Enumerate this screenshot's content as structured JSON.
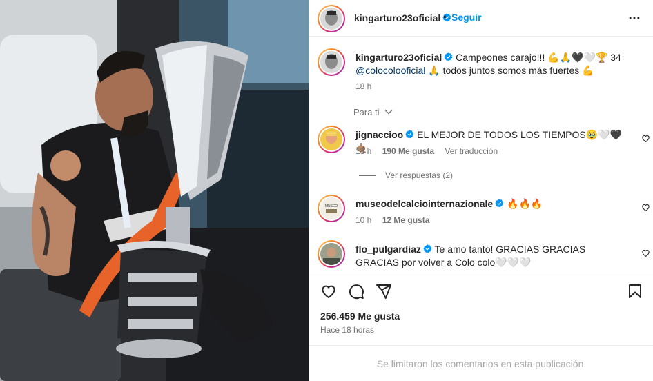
{
  "post": {
    "username": "kingarturo23oficial",
    "follow_label": "Seguir",
    "follow_separator": "•"
  },
  "caption": {
    "username": "kingarturo23oficial",
    "text_line1": "Campeones carajo!!! 💪🙏🖤🤍🏆 34",
    "mention": "@colocolooficial",
    "text_line2": " 🙏 todos juntos somos más fuertes 💪",
    "time": "18 h"
  },
  "for_you_label": "Para ti",
  "comments": [
    {
      "username": "jignaccioo",
      "text": "EL MEJOR DE TODOS LOS TIEMPOS🥹🤍🖤🤙🏽",
      "time": "18 h",
      "likes": "190 Me gusta",
      "translate": "Ver traducción"
    },
    {
      "username": "museodelcalciointernazionale",
      "text": "🔥🔥🔥",
      "time": "10 h",
      "likes": "12 Me gusta"
    },
    {
      "username": "flo_pulgardiaz",
      "text": "Te amo tanto! GRACIAS GRACIAS GRACIAS por volver a Colo colo🤍🤍🤍"
    }
  ],
  "view_replies": "Ver respuestas (2)",
  "like_count": "256.459 Me gusta",
  "posted_ago": "Hace 18 horas",
  "comments_closed": "Se limitaron los comentarios en esta publicación.",
  "colors": {
    "accent": "#0095f6",
    "mention": "#00376b",
    "secondary_text": "#737373",
    "verified_badge": "#0095f6"
  },
  "icons": [
    "more-icon",
    "heart-icon",
    "comment-icon",
    "share-icon",
    "save-icon",
    "verified-icon",
    "chevron-down-icon"
  ]
}
